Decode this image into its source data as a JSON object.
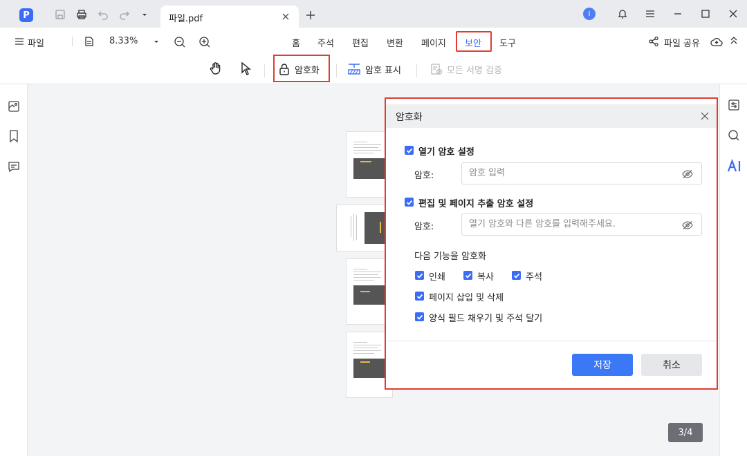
{
  "titlebar": {
    "app_logo": "P",
    "tab_title": "파일.pdf",
    "avatar_initial": "I"
  },
  "menubar": {
    "file_label": "파일",
    "zoom_level": "8.33%",
    "tabs": [
      "홈",
      "주석",
      "편집",
      "변환",
      "페이지",
      "보안",
      "도구"
    ],
    "active_tab": "보안",
    "share_label": "파일 공유"
  },
  "toolbar": {
    "encrypt_label": "암호화",
    "password_display_label": "암호 표시",
    "verify_signatures_label": "모든 서명 검증"
  },
  "dialog": {
    "title": "암호화",
    "open_password_section": "열기 암호 설정",
    "open_password_label": "암호:",
    "open_password_placeholder": "암호 입력",
    "edit_password_section": "편집 및 페이지 추출 암호 설정",
    "edit_password_label": "암호:",
    "edit_password_placeholder": "열기 암호와 다른 암호를 입력해주세요.",
    "encrypt_features_label": "다음 기능을 암호화",
    "options": {
      "print": "인쇄",
      "copy": "복사",
      "annotate": "주석",
      "page_insert_delete": "페이지 삽입 및 삭제",
      "form_fill_comment": "양식 필드 채우기 및 주석 달기"
    },
    "save_label": "저장",
    "cancel_label": "취소"
  },
  "page_indicator": "3/4",
  "colors": {
    "accent": "#3b6cf6",
    "highlight_outline": "#e03c31"
  }
}
